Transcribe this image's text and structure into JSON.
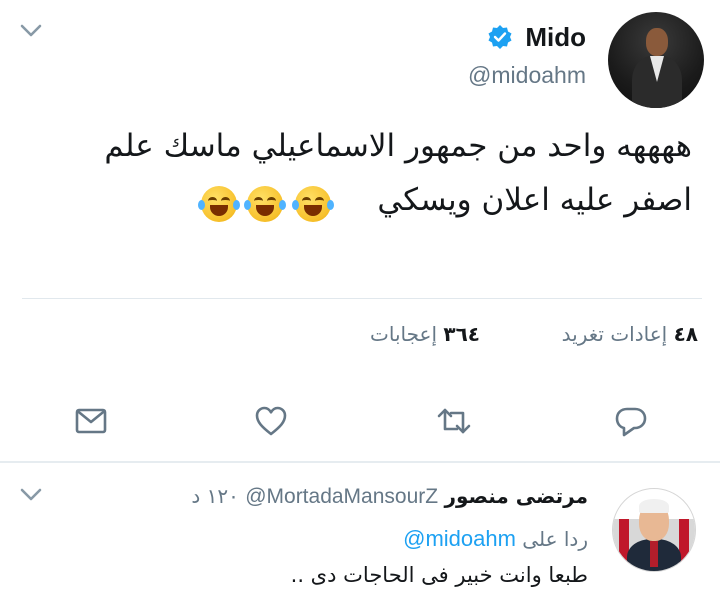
{
  "tweet": {
    "author_name": "Mido",
    "author_handle": "@midoahm",
    "verified": true,
    "text_line1": "ههههه واحد من جمهور الاسماعيلي ماسك علم",
    "text_line2": "اصفر عليه اعلان ويسكي",
    "emojis": [
      "face-with-tears-of-joy",
      "face-with-tears-of-joy",
      "face-with-tears-of-joy"
    ],
    "stats": {
      "retweets_count": "٤٨",
      "retweets_label": "إعادات تغريد",
      "likes_count": "٣٦٤",
      "likes_label": "إعجابات"
    },
    "actions": [
      "reply-icon",
      "retweet-icon",
      "like-icon",
      "direct-message-icon"
    ]
  },
  "reply": {
    "author_name": "مرتضى منصور",
    "author_handle": "@MortadaMansourZ",
    "time": "١٢٠ د",
    "replying_to_label": "ردا على",
    "replying_to_handle": "@midoahm",
    "text": "طبعا وانت خبير فى الحاجات دى .."
  },
  "colors": {
    "accent": "#1da1f2",
    "secondary_text": "#657786",
    "icon": "#657786",
    "divider": "#e1e8ed"
  }
}
